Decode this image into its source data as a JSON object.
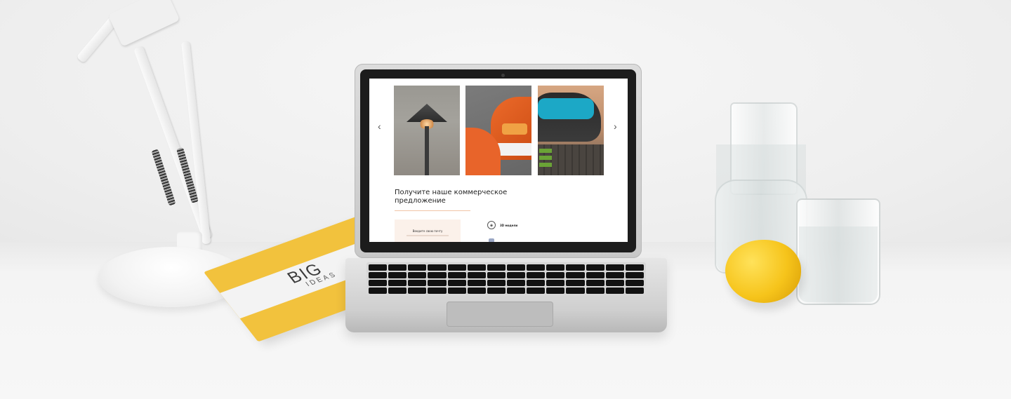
{
  "booklet": {
    "title": "BIG",
    "subtitle": "IDEAS"
  },
  "site": {
    "carousel": {
      "prev_icon": "‹",
      "next_icon": "›",
      "slides": [
        {
          "name": "patio-heater"
        },
        {
          "name": "orange-chair"
        },
        {
          "name": "teal-lounge-sofa"
        }
      ]
    },
    "offer": {
      "title": "Получите наше коммерческое предложение",
      "email_box_label": "Введите свою почту"
    },
    "features": [
      {
        "icon": "3d-model-icon",
        "label": "3D модели"
      }
    ]
  },
  "colors": {
    "accent_line": "#f0c4a6",
    "email_box_bg": "#fbf1ea",
    "booklet_yellow": "#f2c23d"
  }
}
